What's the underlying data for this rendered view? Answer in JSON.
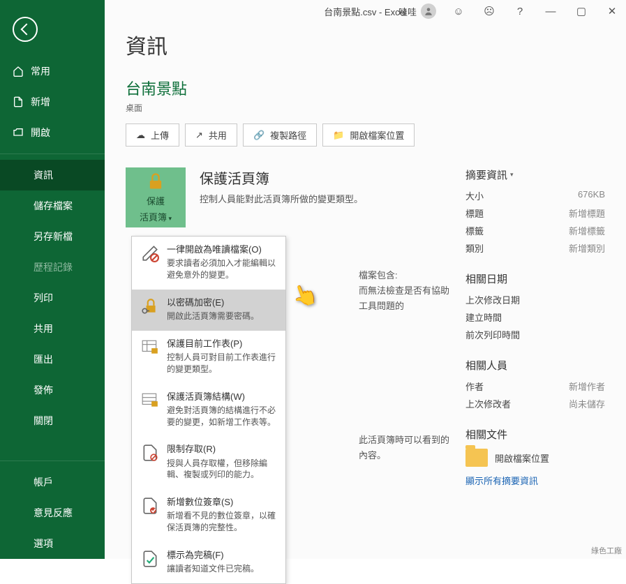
{
  "title_bar": {
    "filename": "台南景點.csv - Excel",
    "user": "哇哇"
  },
  "sidebar": {
    "items": [
      {
        "label": "常用"
      },
      {
        "label": "新增"
      },
      {
        "label": "開啟"
      },
      {
        "label": "資訊"
      },
      {
        "label": "儲存檔案"
      },
      {
        "label": "另存新檔"
      },
      {
        "label": "歷程記錄"
      },
      {
        "label": "列印"
      },
      {
        "label": "共用"
      },
      {
        "label": "匯出"
      },
      {
        "label": "發佈"
      },
      {
        "label": "關閉"
      }
    ],
    "bottom": [
      {
        "label": "帳戶"
      },
      {
        "label": "意見反應"
      },
      {
        "label": "選項"
      }
    ]
  },
  "page": {
    "heading": "資訊",
    "doc_title": "台南景點",
    "doc_location": "桌面",
    "toolbar": {
      "upload": "上傳",
      "share": "共用",
      "copy_path": "複製路徑",
      "open_loc": "開啟檔案位置"
    },
    "protect": {
      "btn_line1": "保護",
      "btn_line2": "活頁簿",
      "title": "保護活頁簿",
      "desc": "控制人員能對此活頁簿所做的變更類型。"
    },
    "inspect": {
      "line1": "檔案包含:",
      "line2": "而無法檢查是否有協助工具問題的"
    },
    "manage": {
      "desc": "此活頁簿時可以看到的內容。"
    }
  },
  "menu": [
    {
      "title": "一律開啟為唯讀檔案(O)",
      "desc": "要求讀者必須加入才能編輯以避免意外的變更。"
    },
    {
      "title": "以密碼加密(E)",
      "desc": "開啟此活頁簿需要密碼。"
    },
    {
      "title": "保護目前工作表(P)",
      "desc": "控制人員可對目前工作表進行的變更類型。"
    },
    {
      "title": "保護活頁簿結構(W)",
      "desc": "避免對活頁簿的結構進行不必要的變更，如新增工作表等。"
    },
    {
      "title": "限制存取(R)",
      "desc": "授與人員存取權，但移除編輯、複製或列印的能力。"
    },
    {
      "title": "新增數位簽章(S)",
      "desc": "新增看不見的數位簽章，以確保活頁簿的完整性。"
    },
    {
      "title": "標示為完稿(F)",
      "desc": "讓讀者知道文件已完稿。"
    }
  ],
  "props": {
    "heading": "摘要資訊",
    "size_l": "大小",
    "size_v": "676KB",
    "title_l": "標題",
    "title_v": "新增標題",
    "tags_l": "標籤",
    "tags_v": "新增標籤",
    "cat_l": "類別",
    "cat_v": "新增類別",
    "dates_h": "相關日期",
    "mod_l": "上次修改日期",
    "created_l": "建立時間",
    "printed_l": "前次列印時間",
    "people_h": "相關人員",
    "author_l": "作者",
    "author_v": "新增作者",
    "lastmod_l": "上次修改者",
    "lastmod_v": "尚未儲存",
    "docs_h": "相關文件",
    "open_loc": "開啟檔案位置",
    "show_all": "顯示所有摘要資訊"
  },
  "watermark": "綠色工廠"
}
